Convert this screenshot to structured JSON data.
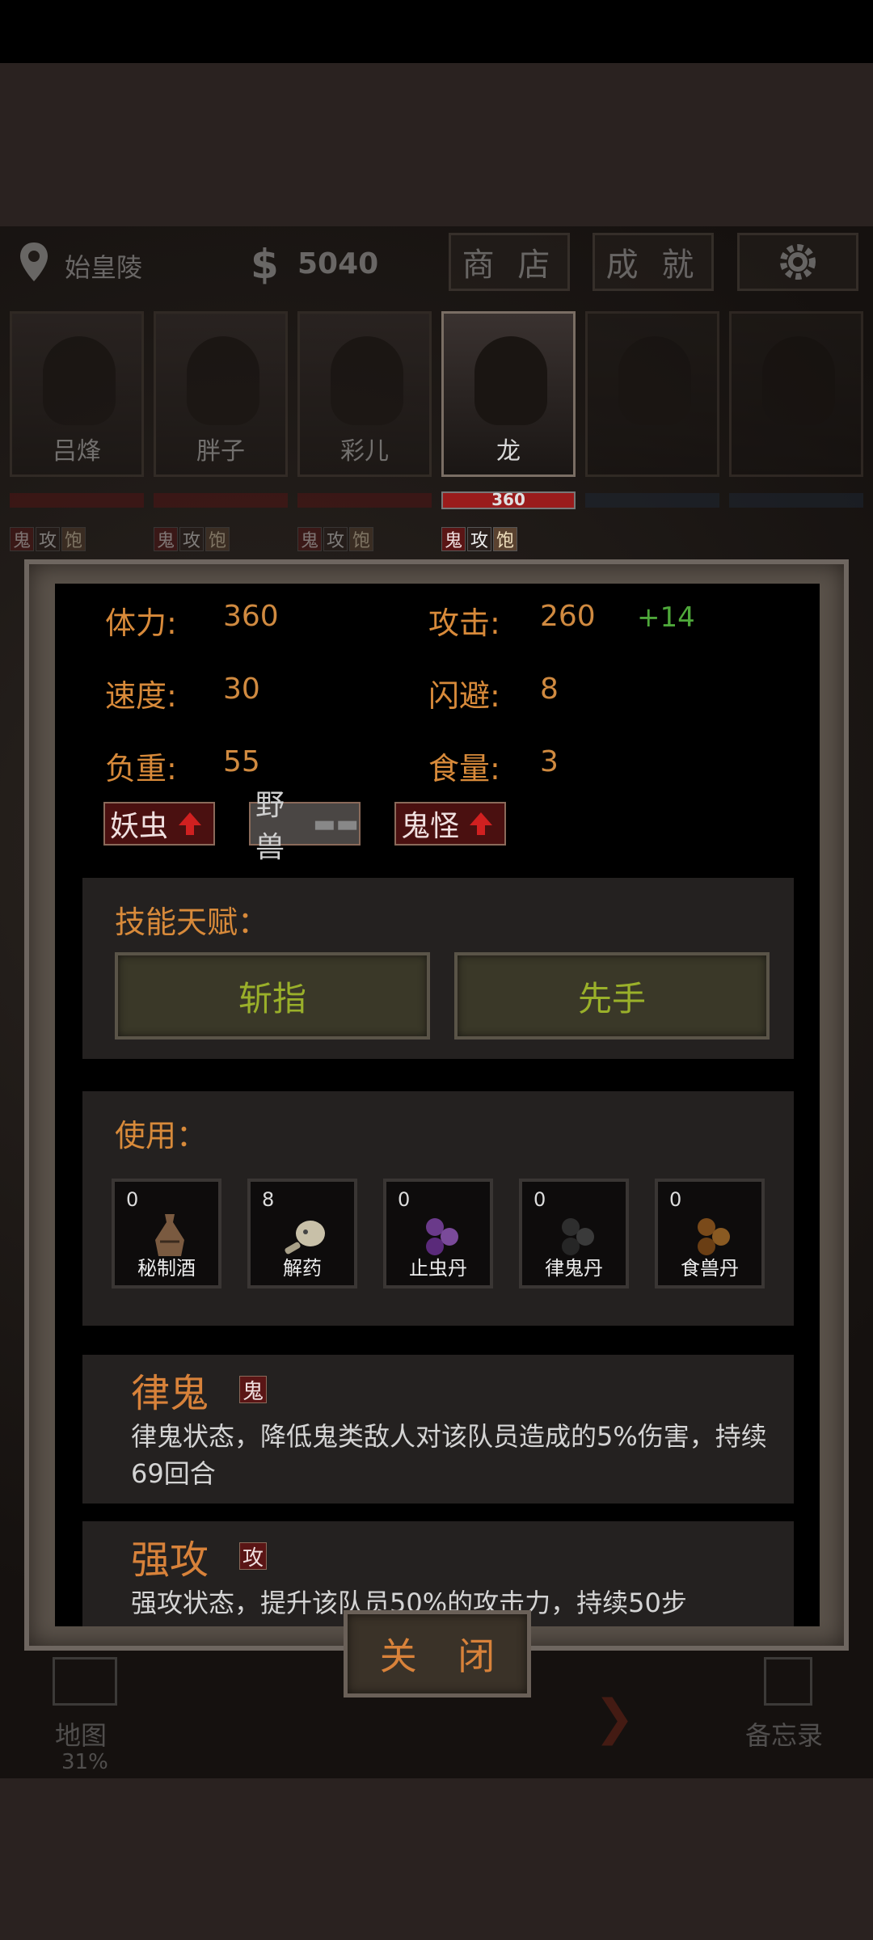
{
  "hud": {
    "location": "始皇陵",
    "money_symbol": "$",
    "money": "5040",
    "shop_label": "商 店",
    "achievements_label": "成 就"
  },
  "team": [
    {
      "name": "吕烽",
      "hp": ""
    },
    {
      "name": "胖子",
      "hp": ""
    },
    {
      "name": "彩儿",
      "hp": ""
    },
    {
      "name": "龙",
      "hp": "360"
    }
  ],
  "status_icons": {
    "gui": "鬼",
    "gong": "攻",
    "bao": "饱"
  },
  "stats": {
    "stamina_label": "体力:",
    "stamina": "360",
    "attack_label": "攻击:",
    "attack": "260",
    "attack_bonus": "+14",
    "speed_label": "速度:",
    "speed": "30",
    "dodge_label": "闪避:",
    "dodge": "8",
    "load_label": "负重:",
    "load": "55",
    "food_label": "食量:",
    "food": "3"
  },
  "resist_tags": [
    {
      "label": "妖虫",
      "state": "up"
    },
    {
      "label": "野兽",
      "state": "none"
    },
    {
      "label": "鬼怪",
      "state": "up"
    }
  ],
  "skills": {
    "title": "技能天赋：",
    "items": [
      "斩指",
      "先手"
    ]
  },
  "use": {
    "title": "使用：",
    "items": [
      {
        "count": "0",
        "name": "秘制酒",
        "icon": "jar-icon"
      },
      {
        "count": "8",
        "name": "解药",
        "icon": "gourd-icon"
      },
      {
        "count": "0",
        "name": "止虫丹",
        "icon": "purple-pills-icon"
      },
      {
        "count": "0",
        "name": "律鬼丹",
        "icon": "black-pills-icon"
      },
      {
        "count": "0",
        "name": "食兽丹",
        "icon": "brown-pills-icon"
      }
    ]
  },
  "buffs": [
    {
      "title": "律鬼",
      "tag": "鬼",
      "desc": "律鬼状态，降低鬼类敌人对该队员造成的5%伤害，持续69回合"
    },
    {
      "title": "强攻",
      "tag": "攻",
      "desc": "强攻状态，提升该队员50%的攻击力，持续50步"
    }
  ],
  "close_label": "关 闭",
  "bottom_nav": {
    "map_label": "地图",
    "map_progress": "31%",
    "memo_label": "备忘录"
  },
  "colors": {
    "accent": "#d88a3a",
    "skill_text": "#9ab02a",
    "bonus": "#4ea83a",
    "hp_red": "#9a1c1c"
  }
}
